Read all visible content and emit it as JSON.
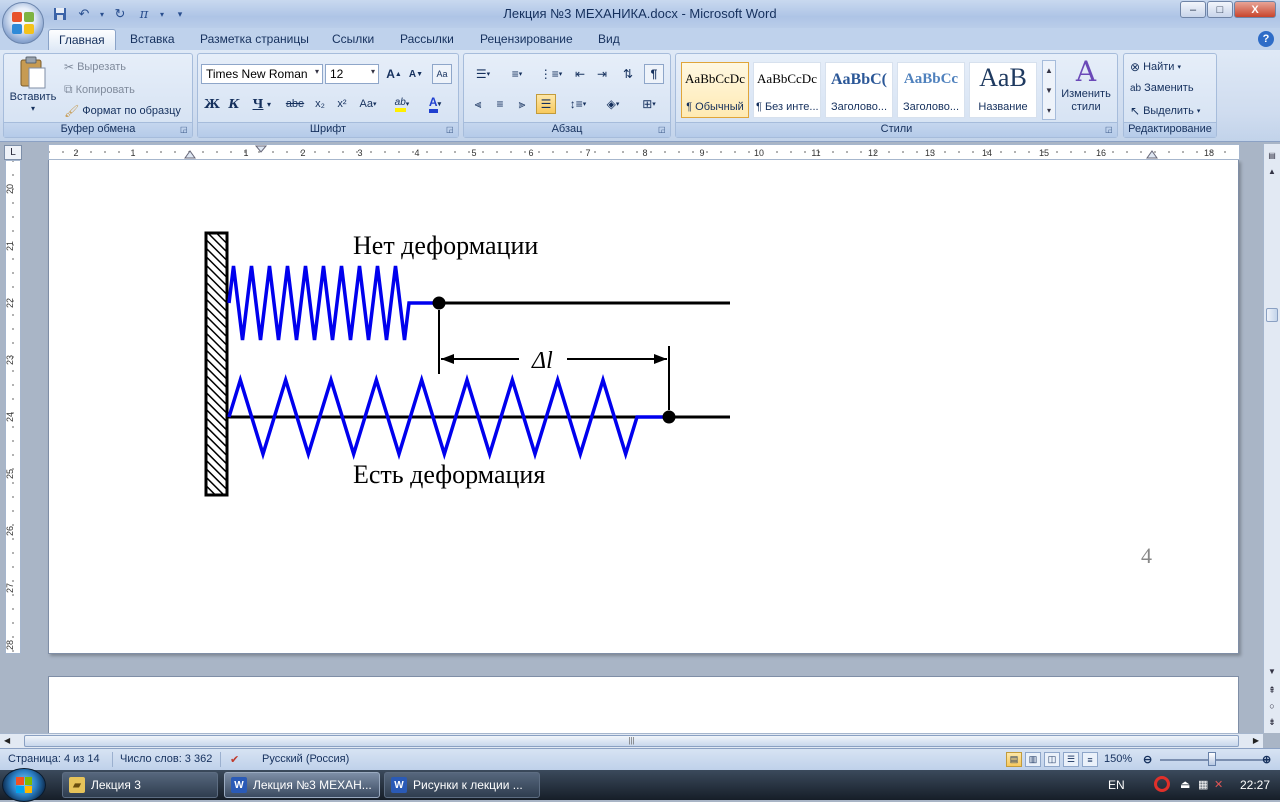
{
  "window": {
    "title": "Лекция №3 МЕХАНИКА.docx - Microsoft Word",
    "minimize": "–",
    "maximize": "□",
    "close": "X"
  },
  "qat": {
    "save_icon": "save-icon",
    "undo_icon": "undo-icon",
    "redo_icon": "redo-icon",
    "pi": "π",
    "customize": "▾"
  },
  "tabs": [
    {
      "label": "Главная",
      "active": true
    },
    {
      "label": "Вставка"
    },
    {
      "label": "Разметка страницы"
    },
    {
      "label": "Ссылки"
    },
    {
      "label": "Рассылки"
    },
    {
      "label": "Рецензирование"
    },
    {
      "label": "Вид"
    }
  ],
  "ribbon": {
    "clipboard": {
      "label": "Буфер обмена",
      "paste": "Вставить",
      "cut": "Вырезать",
      "copy": "Копировать",
      "format_painter": "Формат по образцу"
    },
    "font": {
      "label": "Шрифт",
      "font_name": "Times New Roman",
      "font_size": "12",
      "grow": "A",
      "shrink": "A",
      "clear": "Aa",
      "bold": "Ж",
      "italic": "К",
      "underline": "Ч",
      "strike": "abe",
      "subscript": "x₂",
      "superscript": "x²",
      "case": "Aa",
      "highlight": "ab",
      "color": "A"
    },
    "paragraph": {
      "label": "Абзац",
      "pilcrow": "¶"
    },
    "styles": {
      "label": "Стили",
      "tiles": [
        {
          "sample": "AaBbCcDc",
          "name": "¶ Обычный"
        },
        {
          "sample": "AaBbCcDc",
          "name": "¶ Без инте..."
        },
        {
          "sample": "AaBbC(",
          "name": "Заголово..."
        },
        {
          "sample": "AaBbCc",
          "name": "Заголово..."
        },
        {
          "sample": "AaB",
          "name": "Название"
        }
      ],
      "change_styles": "Изменить стили"
    },
    "editing": {
      "label": "Редактирование",
      "find": "Найти",
      "replace": "Заменить",
      "select": "Выделить"
    }
  },
  "ruler": {
    "h_ticks": [
      "2",
      "1",
      "1",
      "2",
      "3",
      "4",
      "5",
      "6",
      "7",
      "8",
      "9",
      "10",
      "11",
      "12",
      "13",
      "14",
      "15",
      "16",
      "18"
    ],
    "v_ticks": [
      "20",
      "21",
      "22",
      "23",
      "24",
      "25",
      "26",
      "27",
      "28"
    ]
  },
  "document": {
    "label_top": "Нет деформации",
    "label_bottom": "Есть деформация",
    "delta_label": "Δl",
    "page_number": "4",
    "colors": {
      "spring": "#0000ee",
      "line": "#000000"
    }
  },
  "status": {
    "page": "Страница: 4 из 14",
    "words": "Число слов: 3 362",
    "language": "Русский (Россия)",
    "zoom": "150%"
  },
  "taskbar": {
    "items": [
      {
        "label": "Лекция 3",
        "icon": "folder-icon"
      },
      {
        "label": "Лекция №3 МЕХАН...",
        "icon": "word-icon",
        "active": true
      },
      {
        "label": "Рисунки к лекции ...",
        "icon": "word-icon"
      }
    ],
    "lang": "EN",
    "time": "22:27"
  }
}
